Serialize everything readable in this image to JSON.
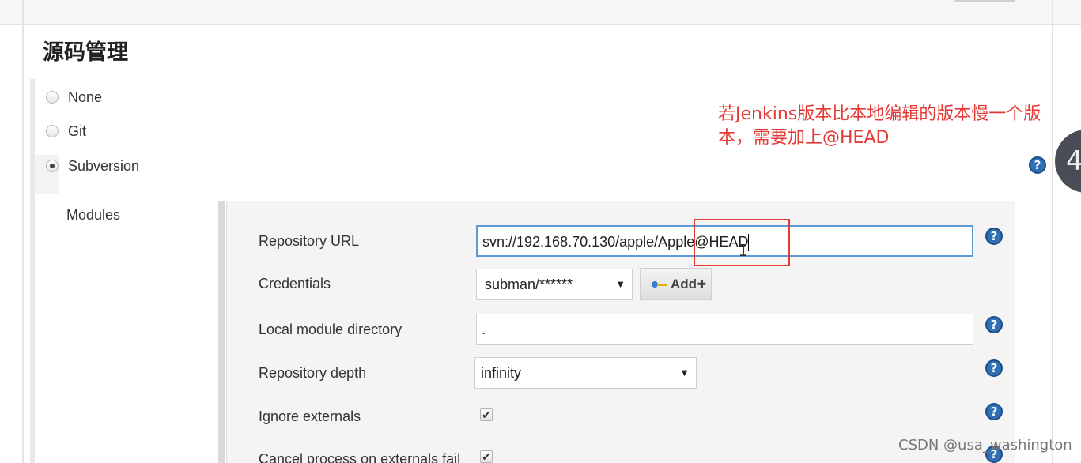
{
  "section": {
    "title": "源码管理"
  },
  "scm": {
    "options": [
      {
        "label": "None",
        "checked": false
      },
      {
        "label": "Git",
        "checked": false
      },
      {
        "label": "Subversion",
        "checked": true
      }
    ]
  },
  "modules": {
    "label": "Modules",
    "repository_url": {
      "label": "Repository URL",
      "value": "svn://192.168.70.130/apple/Apple@HEAD"
    },
    "credentials": {
      "label": "Credentials",
      "selected": "subman/******",
      "add_label": "Add"
    },
    "local_module_directory": {
      "label": "Local module directory",
      "value": "."
    },
    "repository_depth": {
      "label": "Repository depth",
      "selected": "infinity"
    },
    "ignore_externals": {
      "label": "Ignore externals",
      "checked": true
    },
    "cancel_process": {
      "label": "Cancel process on externals fail",
      "checked": true
    }
  },
  "annotation": {
    "text": "若Jenkins版本比本地编辑的版本慢一个版本，需要加上@HEAD"
  },
  "overlay": {
    "badge_text": "4",
    "watermark": "CSDN @usa_washington"
  },
  "help": {
    "glyph": "?"
  },
  "colors": {
    "annotation": "#e53935",
    "help_icon": "#2f6fb5",
    "input_focus": "#5b9bd5"
  }
}
